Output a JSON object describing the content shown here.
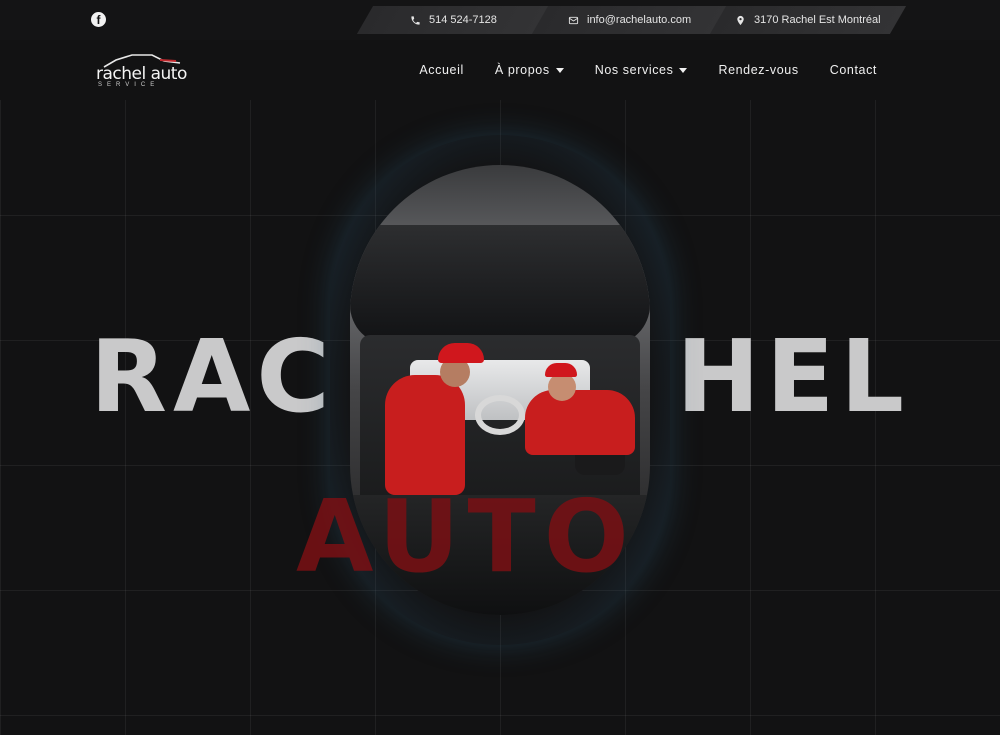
{
  "topbar": {
    "facebook_icon": "facebook-icon",
    "phone": "514 524-7128",
    "email": "info@rachelauto.com",
    "address": "3170 Rachel Est Montréal"
  },
  "logo": {
    "word": "rachel auto",
    "sub": "SERVICE"
  },
  "nav": {
    "items": [
      {
        "label": "Accueil",
        "dropdown": false
      },
      {
        "label": "À propos",
        "dropdown": true
      },
      {
        "label": "Nos services",
        "dropdown": true
      },
      {
        "label": "Rendez-vous",
        "dropdown": false
      },
      {
        "label": "Contact",
        "dropdown": false
      }
    ]
  },
  "hero": {
    "title_line1_left": "RAC",
    "title_line1_right": "HEL",
    "title_line2": "AUTO"
  },
  "colors": {
    "background": "#121213",
    "accent_red": "#7a1014",
    "title_gray": "#c9c9ca"
  }
}
